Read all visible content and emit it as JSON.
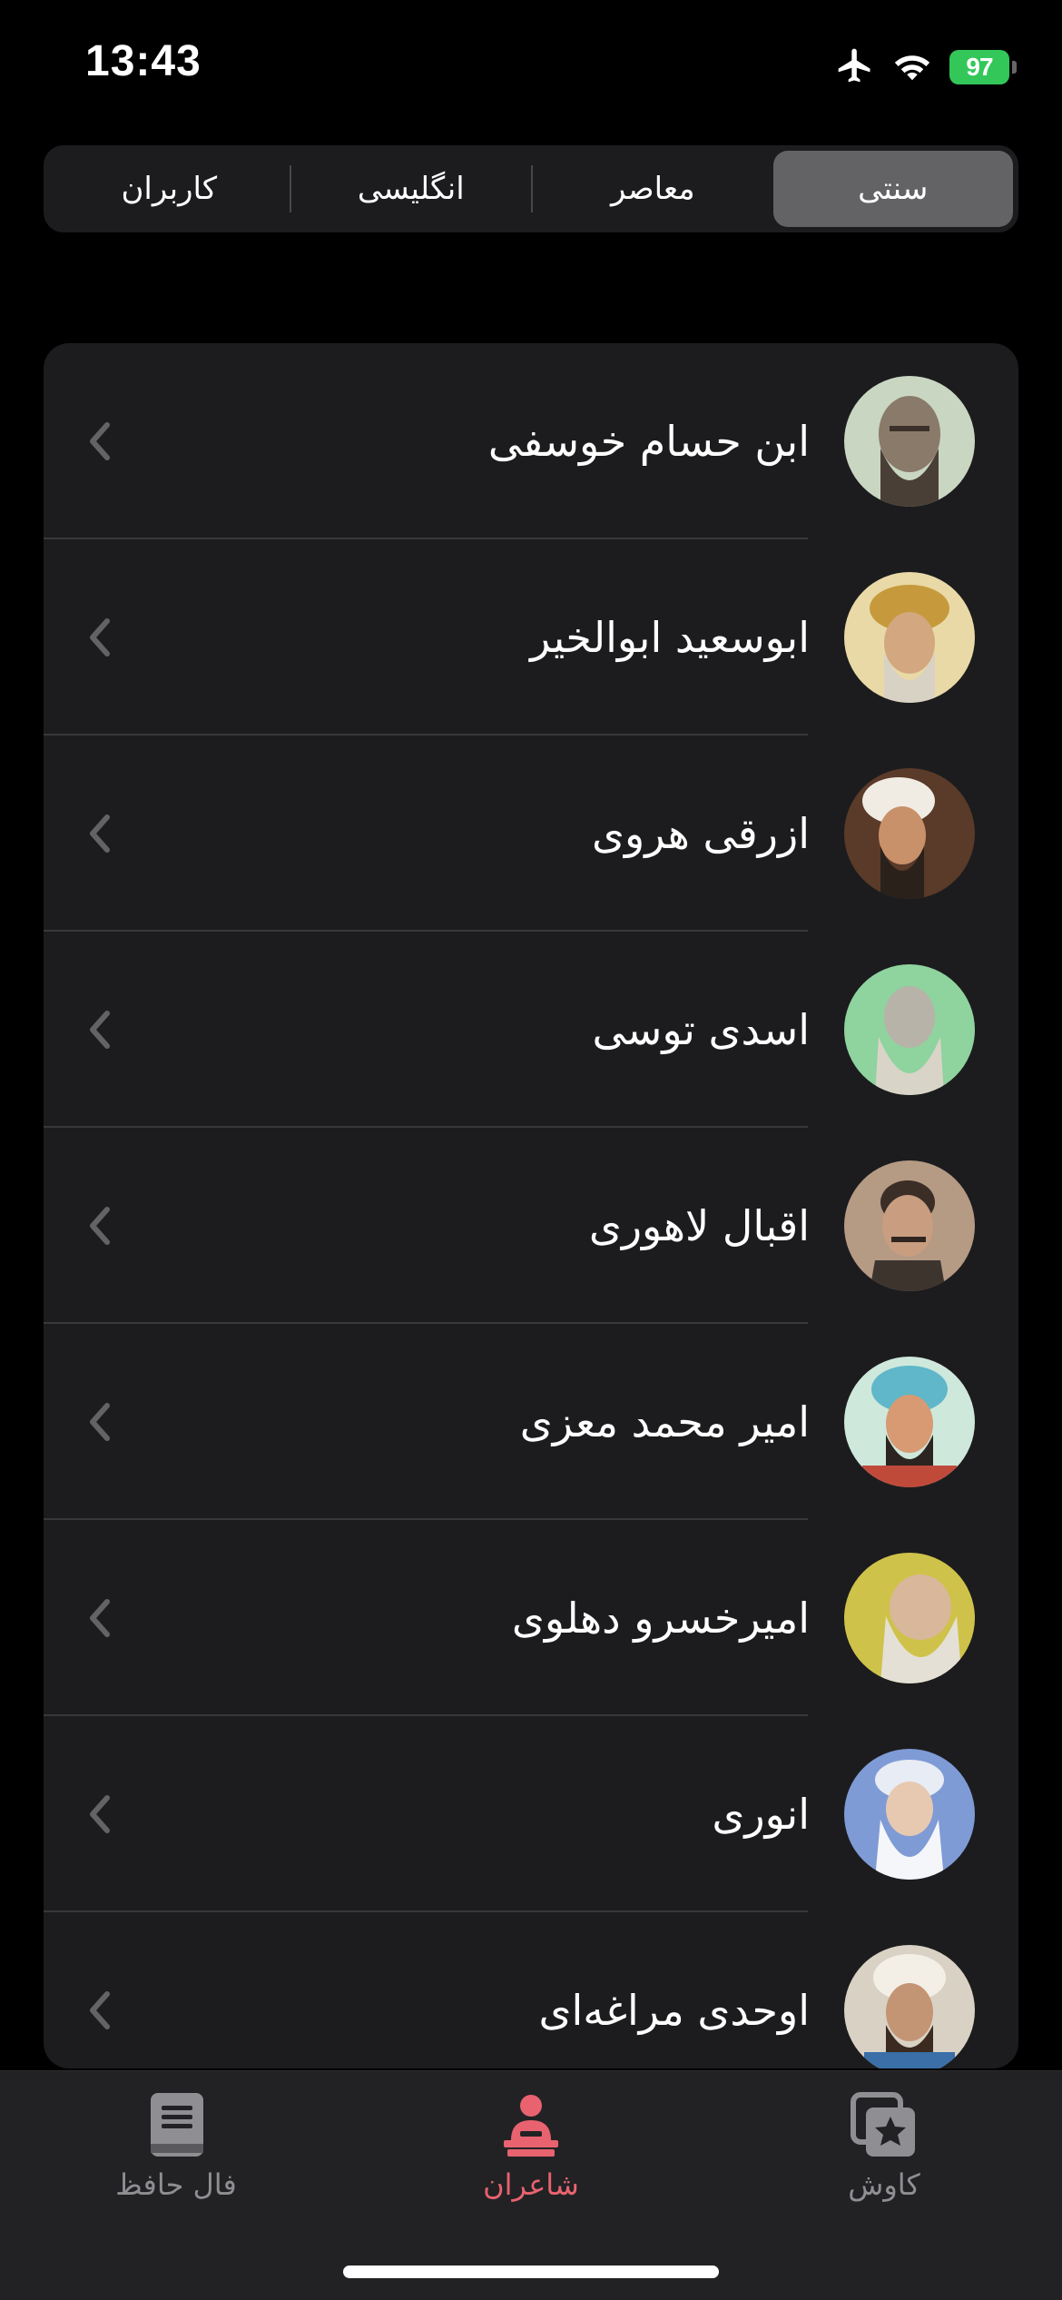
{
  "status_bar": {
    "time": "13:43",
    "battery": "97"
  },
  "segments": {
    "items": [
      {
        "label": "سنتی",
        "selected": true
      },
      {
        "label": "معاصر",
        "selected": false
      },
      {
        "label": "انگلیسی",
        "selected": false
      },
      {
        "label": "کاربران",
        "selected": false
      }
    ]
  },
  "poets": [
    {
      "name": "ابن حسام خوسفی",
      "avatar_bg": "#c9d6c2"
    },
    {
      "name": "ابوسعید ابوالخیر",
      "avatar_bg": "#e9d9a6"
    },
    {
      "name": "ازرقی هروی",
      "avatar_bg": "#5a3a28"
    },
    {
      "name": "اسدی توسی",
      "avatar_bg": "#8fd39e"
    },
    {
      "name": "اقبال لاهوری",
      "avatar_bg": "#b59a84"
    },
    {
      "name": "امیر محمد معزی",
      "avatar_bg": "#cfe8dc"
    },
    {
      "name": "امیرخسرو دهلوی",
      "avatar_bg": "#cfc24a"
    },
    {
      "name": "انوری",
      "avatar_bg": "#7f9bd6"
    },
    {
      "name": "اوحدی مراغه‌ای",
      "avatar_bg": "#d9d2c4"
    }
  ],
  "tab_bar": {
    "tabs": [
      {
        "label": "کاوش",
        "icon": "star-stack-icon",
        "active": false
      },
      {
        "label": "شاعران",
        "icon": "poet-icon",
        "active": true
      },
      {
        "label": "فال حافظ",
        "icon": "book-icon",
        "active": false
      }
    ]
  },
  "colors": {
    "background": "#000000",
    "card": "#1c1c1e",
    "accent": "#e8636f",
    "battery": "#33c759"
  }
}
